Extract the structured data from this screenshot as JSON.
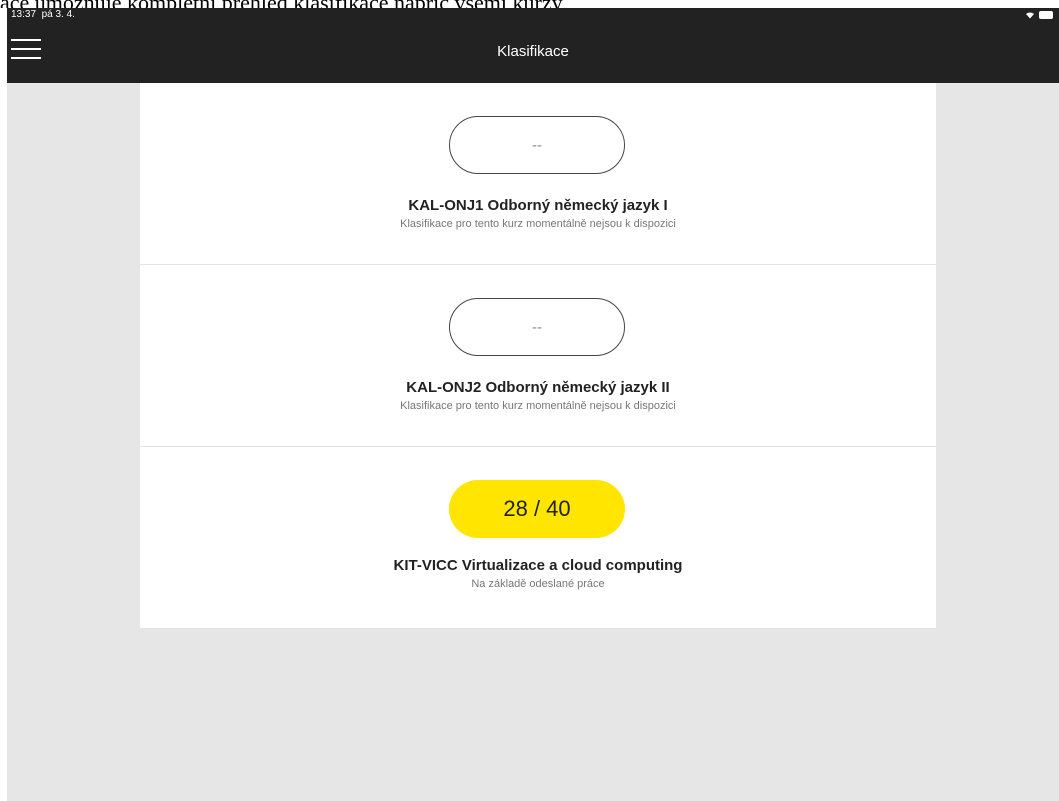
{
  "caption": "ace umožňuje kompletní přehled klasifikace napříč všemi kurzy",
  "status_bar": {
    "time": "13:37",
    "date": "pá 3. 4.",
    "wifi_icon": "wifi-icon",
    "battery_icon": "battery-icon"
  },
  "navbar": {
    "title": "Klasifikace",
    "menu_icon": "hamburger-menu-icon"
  },
  "courses": [
    {
      "grade": "--",
      "grade_state": "empty",
      "title": "KAL-ONJ1 Odborný německý jazyk I",
      "subtitle": "Klasifikace pro tento kurz momentálně nejsou k dispozici"
    },
    {
      "grade": "--",
      "grade_state": "empty",
      "title": "KAL-ONJ2 Odborný německý jazyk II",
      "subtitle": "Klasifikace pro tento kurz momentálně nejsou k dispozici"
    },
    {
      "grade": "28 / 40",
      "grade_state": "filled",
      "title": "KIT-VICC Virtualizace a cloud computing",
      "subtitle": "Na základě odeslané práce"
    }
  ],
  "colors": {
    "header_bg": "#222222",
    "page_bg": "#e6e6e6",
    "card_bg": "#ffffff",
    "grade_highlight": "#ffe500"
  }
}
